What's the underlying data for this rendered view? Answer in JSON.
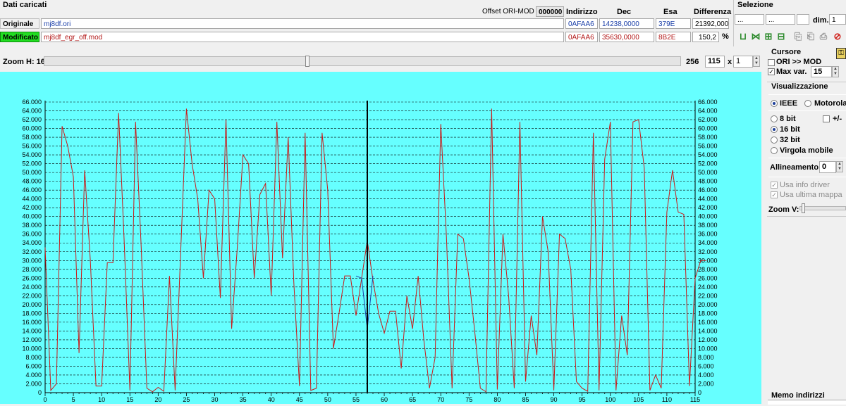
{
  "header": {
    "dati_caricati": "Dati caricati",
    "offset_label": "Offset ORI-MOD",
    "offset_value": "000000",
    "col_indirizzo": "Indirizzo",
    "col_dec": "Dec",
    "col_esa": "Esa",
    "col_differenza": "Differenza"
  },
  "files": [
    {
      "label": "Originale",
      "name": "mj8df.ori",
      "indirizzo": "0AFAA6",
      "dec": "14238,0000",
      "esa": "379E",
      "diff": "21392,000"
    },
    {
      "label": "Modificato",
      "name": "mj8df_egr_off.mod",
      "indirizzo": "0AFAA6",
      "dec": "35630,0000",
      "esa": "8B2E",
      "diff": "150,2",
      "diff_unit": "%"
    }
  ],
  "selezione": {
    "title": "Selezione",
    "field1": "...",
    "field2": "...",
    "dim_label": "dim.",
    "dim_value": "1"
  },
  "zoom": {
    "label": "Zoom H: 16",
    "max": "256",
    "value": "115",
    "x_label": "x",
    "mult": "1"
  },
  "cursore": {
    "title": "Cursore",
    "ori_mod_label": "ORI >> MOD",
    "ori_mod_checked": false,
    "max_var_label": "Max var.",
    "max_var_checked": true,
    "max_var_value": "15"
  },
  "visualizzazione": {
    "title": "Visualizzazione",
    "ieee": "IEEE",
    "motorola": "Motorola",
    "bit8": "8 bit",
    "plusminus": "+/-",
    "bit16": "16 bit",
    "bit32": "32 bit",
    "virgola": "Virgola mobile",
    "allineamento_label": "Allineamento:",
    "allineamento_value": "0",
    "usa_info_driver": "Usa info driver",
    "usa_ultima_mappa": "Usa ultima mappa",
    "zoom_v": "Zoom V:"
  },
  "memo": {
    "title": "Memo indirizzi"
  },
  "colors": {
    "chart_bg": "#66ffff",
    "mod_line": "#cc1a1a",
    "ori_line": "#1f3fa8",
    "cursor": "#000000",
    "modificato_bg": "#22dd22"
  },
  "chart_data": {
    "type": "line",
    "xlim": [
      0,
      115
    ],
    "ylim": [
      0,
      66000
    ],
    "x_ticks": [
      0,
      5,
      10,
      15,
      20,
      25,
      30,
      35,
      40,
      45,
      50,
      55,
      60,
      65,
      70,
      75,
      80,
      85,
      90,
      95,
      100,
      105,
      110,
      115
    ],
    "y_ticks": [
      "0",
      "2.000",
      "4.000",
      "6.000",
      "8.000",
      "10.000",
      "12.000",
      "14.000",
      "16.000",
      "18.000",
      "20.000",
      "22.000",
      "24.000",
      "26.000",
      "28.000",
      "30.000",
      "32.000",
      "34.000",
      "36.000",
      "38.000",
      "40.000",
      "42.000",
      "44.000",
      "46.000",
      "48.000",
      "50.000",
      "52.000",
      "54.000",
      "56.000",
      "58.000",
      "60.000",
      "62.000",
      "64.000",
      "66.000"
    ],
    "grid": true,
    "cursor_x": 57,
    "series": [
      {
        "name": "Modificato",
        "color": "#cc1a1a",
        "values": [
          33000,
          500,
          2000,
          60500,
          56000,
          49000,
          9000,
          50500,
          30000,
          1500,
          1500,
          29500,
          29500,
          63500,
          34000,
          500,
          61500,
          33000,
          1000,
          200,
          1200,
          300,
          26500,
          500,
          32500,
          64500,
          52000,
          44000,
          26000,
          46000,
          44000,
          21500,
          62000,
          14500,
          33000,
          54000,
          52000,
          26000,
          45000,
          47500,
          22000,
          61500,
          30500,
          58000,
          25000,
          1500,
          59000,
          500,
          1000,
          59000,
          46000,
          10000,
          18000,
          26500,
          26500,
          17500,
          26000,
          34500,
          25500,
          18000,
          13500,
          18500,
          18500,
          5500,
          22000,
          14500,
          26500,
          12000,
          1000,
          8000,
          61000,
          35500,
          1000,
          36000,
          35000,
          26000,
          14000,
          1000,
          200,
          64500,
          700,
          36000,
          22000,
          1000,
          61500,
          2500,
          17500,
          8500,
          40000,
          32000,
          500,
          36000,
          35000,
          28000,
          2500,
          1000,
          300,
          59000,
          500,
          53000,
          61500,
          500,
          17500,
          8500,
          61500,
          62000,
          51000,
          500,
          4000,
          1000,
          41000,
          50500,
          41000,
          40500,
          1500,
          26000,
          30000,
          30000
        ]
      },
      {
        "name": "Originale",
        "color": "#1f3fa8",
        "values": [
          null,
          null,
          null,
          null,
          null,
          null,
          null,
          null,
          null,
          null,
          null,
          null,
          null,
          null,
          null,
          null,
          null,
          null,
          null,
          null,
          null,
          null,
          null,
          null,
          null,
          null,
          null,
          null,
          null,
          null,
          null,
          null,
          null,
          null,
          null,
          null,
          null,
          null,
          null,
          null,
          null,
          null,
          null,
          null,
          null,
          null,
          null,
          null,
          null,
          null,
          null,
          null,
          null,
          null,
          null,
          26500,
          26000,
          14500,
          26500,
          null
        ]
      }
    ]
  }
}
